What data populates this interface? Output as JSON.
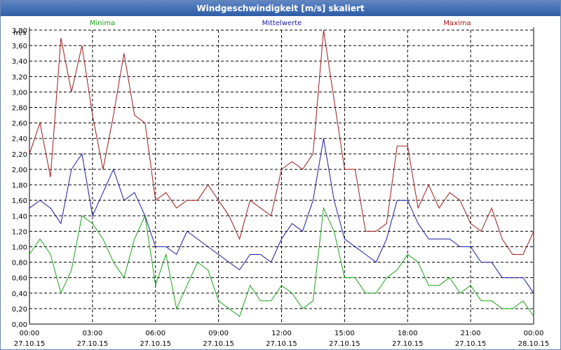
{
  "window": {
    "title": "Windgeschwindigkeit [m/s] skaliert"
  },
  "chart_data": {
    "type": "line",
    "title": "Windgeschwindigkeit [m/s] skaliert",
    "ylabel": "m/s",
    "ylim": [
      0,
      3.8
    ],
    "y_ticks": [
      "0,00",
      "0,20",
      "0,40",
      "0,60",
      "0,80",
      "1,00",
      "1,20",
      "1,40",
      "1,60",
      "1,80",
      "2,00",
      "2,20",
      "2,40",
      "2,60",
      "2,80",
      "3,00",
      "3,20",
      "3,40",
      "3,60",
      "3,80"
    ],
    "x_ticks": [
      {
        "time": "00:00",
        "date": "27.10.15"
      },
      {
        "time": "03:00",
        "date": "27.10.15"
      },
      {
        "time": "06:00",
        "date": "27.10.15"
      },
      {
        "time": "09:00",
        "date": "27.10.15"
      },
      {
        "time": "12:00",
        "date": "27.10.15"
      },
      {
        "time": "15:00",
        "date": "27.10.15"
      },
      {
        "time": "18:00",
        "date": "27.10.15"
      },
      {
        "time": "21:00",
        "date": "27.10.15"
      },
      {
        "time": "00:00",
        "date": "28.10.15"
      }
    ],
    "grid": true,
    "legend": "top",
    "series": [
      {
        "name": "Minima",
        "color": "#1aa51a",
        "x": [
          0,
          0.5,
          1,
          1.5,
          2,
          2.5,
          3,
          3.5,
          4,
          4.5,
          5,
          5.5,
          6,
          6.5,
          7,
          7.5,
          8,
          8.5,
          9,
          9.5,
          10,
          10.5,
          11,
          11.5,
          12,
          12.5,
          13,
          13.5,
          14,
          14.5,
          15,
          15.5,
          16,
          16.5,
          17,
          17.5,
          18,
          18.5,
          19,
          19.5,
          20,
          20.5,
          21,
          21.5,
          22,
          22.5,
          23,
          23.5,
          24
        ],
        "values": [
          0.9,
          1.1,
          0.9,
          0.4,
          0.7,
          1.4,
          1.3,
          1.1,
          0.8,
          0.6,
          1.1,
          1.4,
          0.5,
          0.9,
          0.2,
          0.5,
          0.8,
          0.7,
          0.3,
          0.2,
          0.1,
          0.5,
          0.3,
          0.3,
          0.5,
          0.4,
          0.2,
          0.3,
          1.5,
          1.2,
          0.6,
          0.6,
          0.4,
          0.4,
          0.6,
          0.7,
          0.9,
          0.8,
          0.5,
          0.5,
          0.6,
          0.4,
          0.5,
          0.3,
          0.3,
          0.2,
          0.2,
          0.3,
          0.1
        ]
      },
      {
        "name": "Mittelwerte",
        "color": "#1a1aa0",
        "x": [
          0,
          0.5,
          1,
          1.5,
          2,
          2.5,
          3,
          3.5,
          4,
          4.5,
          5,
          5.5,
          6,
          6.5,
          7,
          7.5,
          8,
          8.5,
          9,
          9.5,
          10,
          10.5,
          11,
          11.5,
          12,
          12.5,
          13,
          13.5,
          14,
          14.5,
          15,
          15.5,
          16,
          16.5,
          17,
          17.5,
          18,
          18.5,
          19,
          19.5,
          20,
          20.5,
          21,
          21.5,
          22,
          22.5,
          23,
          23.5,
          24
        ],
        "values": [
          1.5,
          1.6,
          1.5,
          1.3,
          2.0,
          2.2,
          1.4,
          1.7,
          2.0,
          1.6,
          1.7,
          1.4,
          1.0,
          1.0,
          0.9,
          1.2,
          1.1,
          1.0,
          0.9,
          0.8,
          0.7,
          0.9,
          0.9,
          0.8,
          1.1,
          1.3,
          1.2,
          1.6,
          2.4,
          1.6,
          1.1,
          1.0,
          0.9,
          0.8,
          1.1,
          1.6,
          1.6,
          1.3,
          1.1,
          1.1,
          1.1,
          1.0,
          1.0,
          0.8,
          0.8,
          0.6,
          0.6,
          0.6,
          0.4
        ]
      },
      {
        "name": "Maxima",
        "color": "#a01a1a",
        "x": [
          0,
          0.5,
          1,
          1.5,
          2,
          2.5,
          3,
          3.5,
          4,
          4.5,
          5,
          5.5,
          6,
          6.5,
          7,
          7.5,
          8,
          8.5,
          9,
          9.5,
          10,
          10.5,
          11,
          11.5,
          12,
          12.5,
          13,
          13.5,
          14,
          14.5,
          15,
          15.5,
          16,
          16.5,
          17,
          17.5,
          18,
          18.5,
          19,
          19.5,
          20,
          20.5,
          21,
          21.5,
          22,
          22.5,
          23,
          23.5,
          24
        ],
        "values": [
          2.2,
          2.6,
          1.9,
          3.7,
          3.0,
          3.6,
          2.7,
          2.0,
          2.7,
          3.5,
          2.7,
          2.6,
          1.6,
          1.7,
          1.5,
          1.6,
          1.6,
          1.8,
          1.6,
          1.4,
          1.1,
          1.6,
          1.5,
          1.4,
          2.0,
          2.1,
          2.0,
          2.2,
          3.8,
          2.9,
          2.0,
          2.0,
          1.2,
          1.2,
          1.3,
          2.3,
          2.3,
          1.5,
          1.8,
          1.5,
          1.7,
          1.6,
          1.3,
          1.2,
          1.5,
          1.1,
          0.9,
          0.9,
          1.2
        ]
      }
    ]
  }
}
